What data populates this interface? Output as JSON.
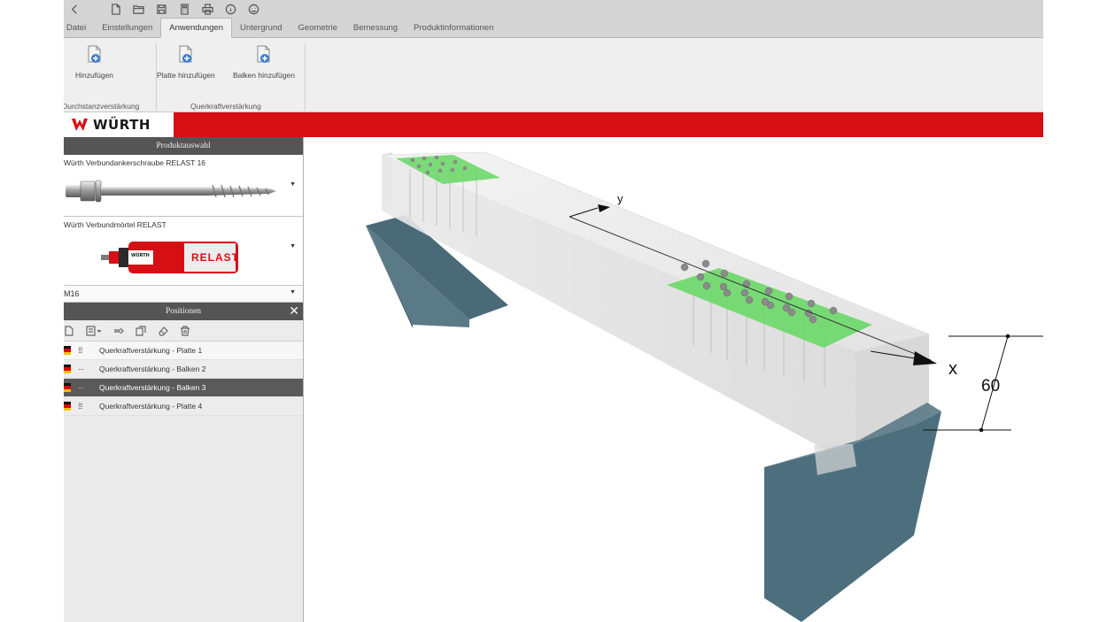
{
  "quick_access": {
    "icons": [
      "back-arrow-icon",
      "new-file-icon",
      "open-folder-icon",
      "save-icon",
      "calculator-icon",
      "print-icon",
      "info-icon",
      "smiley-icon"
    ]
  },
  "ribbon_tabs": [
    {
      "label": "Datei",
      "active": false
    },
    {
      "label": "Einstellungen",
      "active": false
    },
    {
      "label": "Anwendungen",
      "active": true
    },
    {
      "label": "Untergrund",
      "active": false
    },
    {
      "label": "Geometrie",
      "active": false
    },
    {
      "label": "Bemessung",
      "active": false
    },
    {
      "label": "Produktinformationen",
      "active": false
    }
  ],
  "ribbon": {
    "group_durchstanz": {
      "label": "Durchstanzverstärkung",
      "add_label": "Hinzufügen"
    },
    "group_querkraft": {
      "label": "Querkraftverstärkung",
      "add_plate_label": "Platte hinzufügen",
      "add_beam_label": "Balken hinzufügen"
    }
  },
  "brand": {
    "wordmark": "WÜRTH",
    "color": "#d60f14"
  },
  "product_panel": {
    "title": "Produktauswahl",
    "anchor_label": "Würth Verbundankerschraube RELAST 16",
    "mortar_label": "Würth Verbundmörtel RELAST",
    "cartridge_text": "RELAST",
    "cartridge_brand": "WÜRTH",
    "size_value": "M16"
  },
  "positions_panel": {
    "title": "Positionen",
    "close_label": "✕",
    "items": [
      {
        "label": "Querkraftverstärkung - Platte 1",
        "selected": false
      },
      {
        "label": "Querkraftverstärkung - Balken 2",
        "selected": false
      },
      {
        "label": "Querkraftverstärkung - Balken 3",
        "selected": true
      },
      {
        "label": "Querkraftverstärkung - Platte 4",
        "selected": false
      }
    ]
  },
  "viewport": {
    "axis_x_label": "x",
    "axis_y_label": "y",
    "dimension_label": "60",
    "concrete_color": "#e6e6e6",
    "plate_color": "#6ed86a",
    "support_color": "#4d6f7d"
  }
}
